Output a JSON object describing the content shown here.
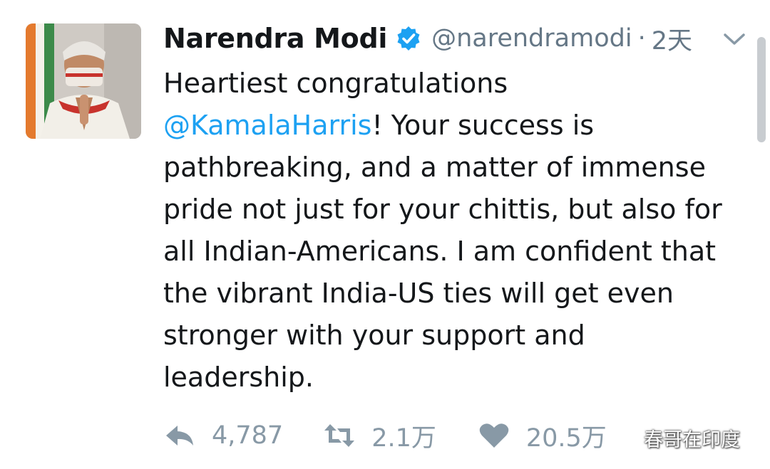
{
  "tweet": {
    "author_name": "Narendra Modi",
    "author_handle": "@narendramodi",
    "separator": "·",
    "time": "2天",
    "verified_icon": "verified-badge-icon",
    "text_lines": [
      {
        "parts": [
          {
            "text": "Heartiest congratulations",
            "mention": false
          }
        ]
      },
      {
        "parts": [
          {
            "text": "@KamalaHarris",
            "mention": true
          },
          {
            "text": "! Your success is",
            "mention": false
          }
        ]
      },
      {
        "parts": [
          {
            "text": "pathbreaking, and a matter of immense",
            "mention": false
          }
        ]
      },
      {
        "parts": [
          {
            "text": "pride not just for your chittis, but also for",
            "mention": false
          }
        ]
      },
      {
        "parts": [
          {
            "text": "all Indian-Americans. I am confident that",
            "mention": false
          }
        ]
      },
      {
        "parts": [
          {
            "text": "the vibrant India-US ties will get even",
            "mention": false
          }
        ]
      },
      {
        "parts": [
          {
            "text": "stronger with your support and",
            "mention": false
          }
        ]
      },
      {
        "parts": [
          {
            "text": "leadership.",
            "mention": false
          }
        ]
      }
    ],
    "actions": {
      "reply_count": "4,787",
      "retweet_count": "2.1万",
      "like_count": "20.5万"
    }
  },
  "watermark": {
    "text": "春哥在印度"
  },
  "colors": {
    "mention": "#1da1f2",
    "verified": "#1da1f2",
    "muted": "#657786",
    "action_icons": "#8899a6"
  }
}
